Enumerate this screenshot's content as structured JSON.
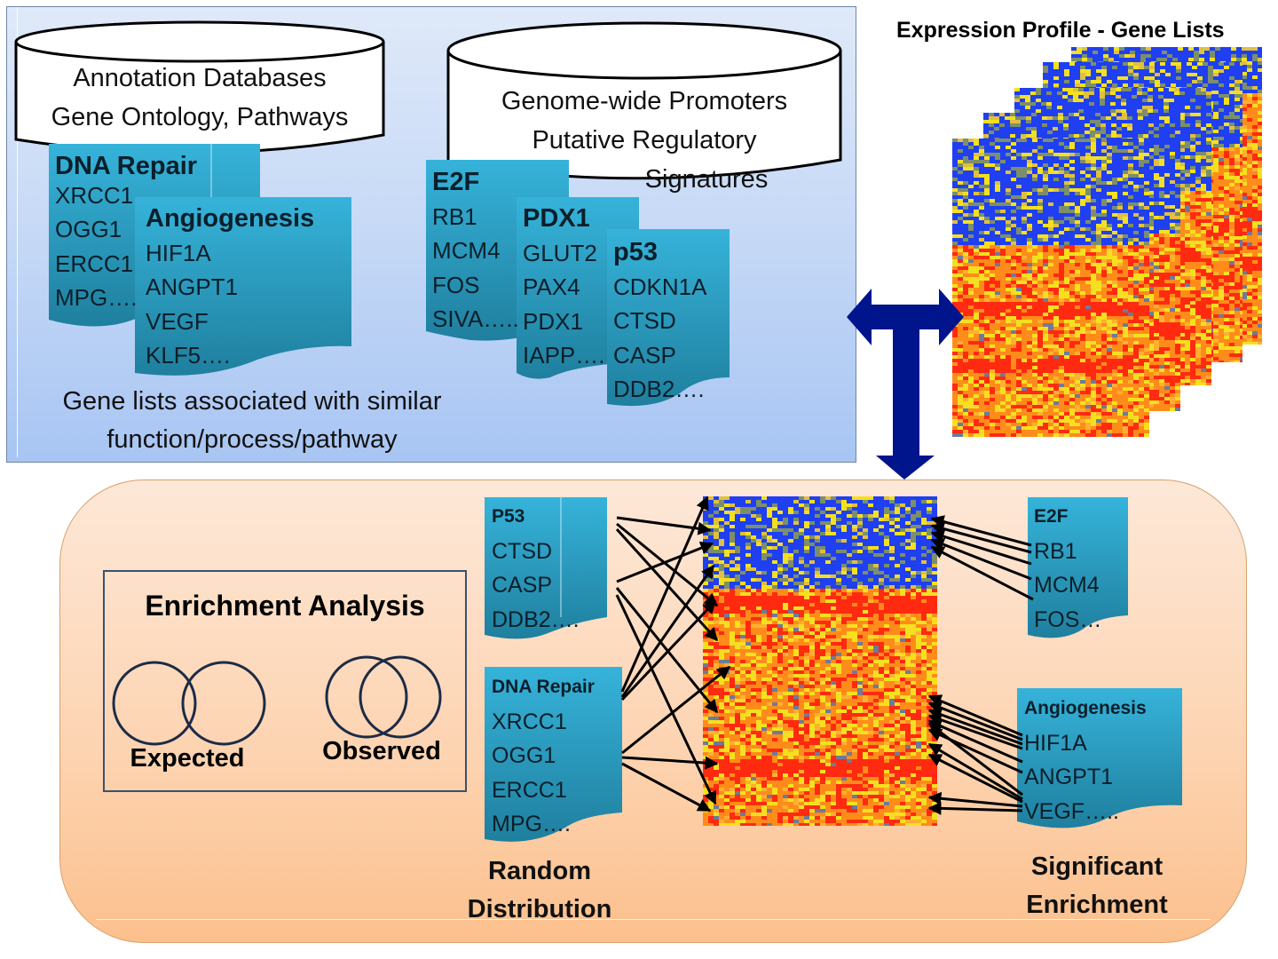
{
  "top_section": {
    "annotation_db": {
      "line1": "Annotation Databases",
      "line2": "Gene Ontology, Pathways"
    },
    "promoter_db": {
      "line1": "Genome-wide Promoters",
      "line2": "Putative Regulatory",
      "line3": "Signatures"
    },
    "gene_lists": [
      {
        "title": "DNA Repair",
        "genes": [
          "XRCC1",
          "OGG1",
          "ERCC1",
          "MPG…."
        ]
      },
      {
        "title": "Angiogenesis",
        "genes": [
          "HIF1A",
          "ANGPT1",
          "VEGF",
          "KLF5…."
        ]
      },
      {
        "title": "E2F",
        "genes": [
          "RB1",
          "MCM4",
          "FOS",
          "SIVA….."
        ]
      },
      {
        "title": "PDX1",
        "genes": [
          "GLUT2",
          "PAX4",
          "PDX1",
          "IAPP…."
        ]
      },
      {
        "title": "p53",
        "genes": [
          "CDKN1A",
          "CTSD",
          "CASP",
          "DDB2…."
        ]
      }
    ],
    "caption_line1": "Gene lists associated with similar",
    "caption_line2": "function/process/pathway"
  },
  "expression_profile": {
    "title": "Expression Profile - Gene Lists",
    "layer_count": 5
  },
  "connector_icon": "t-double-arrow-icon",
  "bottom_section": {
    "enrichment": {
      "title": "Enrichment Analysis",
      "expected_label": "Expected",
      "observed_label": "Observed"
    },
    "random_lists": [
      {
        "title": "P53",
        "genes": [
          "CTSD",
          "CASP",
          "DDB2…."
        ]
      },
      {
        "title": "DNA Repair",
        "genes": [
          "XRCC1",
          "OGG1",
          "ERCC1",
          "MPG…."
        ]
      }
    ],
    "random_caption_line1": "Random",
    "random_caption_line2": "Distribution",
    "significant_lists": [
      {
        "title": "E2F",
        "genes": [
          "RB1",
          "MCM4",
          "FOS…"
        ]
      },
      {
        "title": "Angiogenesis",
        "genes": [
          "HIF1A",
          "ANGPT1",
          "VEGF….."
        ]
      }
    ],
    "significant_caption_line1": "Significant",
    "significant_caption_line2": "Enrichment"
  },
  "colors": {
    "doc_top": "#33aed4",
    "doc_bottom": "#2184a2",
    "arrow_navy": "#000f8c",
    "heat_blue": "#1f3ff0",
    "heat_orange": "#ff8c1a",
    "heat_red": "#ff2a10",
    "heat_yellow": "#f5e020"
  }
}
